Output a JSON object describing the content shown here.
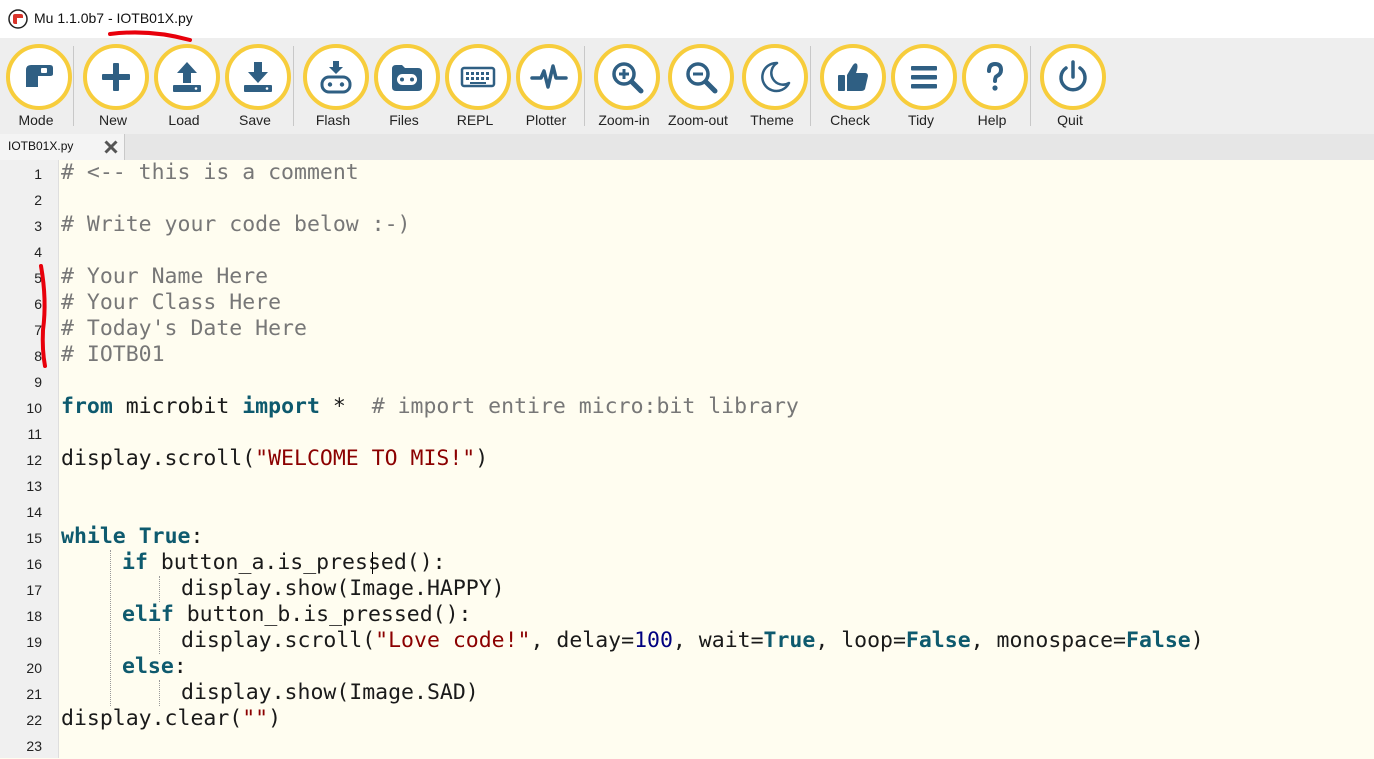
{
  "window": {
    "app_name": "Mu 1.1.0b7",
    "separator": " - ",
    "file_name": "IOTB01X.py"
  },
  "toolbar": {
    "buttons": [
      {
        "label": "Mode",
        "icon": "mode-icon"
      },
      {
        "label": "New",
        "icon": "plus-icon"
      },
      {
        "label": "Load",
        "icon": "upload-icon"
      },
      {
        "label": "Save",
        "icon": "download-icon"
      },
      {
        "label": "Flash",
        "icon": "flash-device-icon"
      },
      {
        "label": "Files",
        "icon": "microbit-icon"
      },
      {
        "label": "REPL",
        "icon": "keyboard-icon"
      },
      {
        "label": "Plotter",
        "icon": "pulse-icon"
      },
      {
        "label": "Zoom-in",
        "icon": "zoom-in-icon"
      },
      {
        "label": "Zoom-out",
        "icon": "zoom-out-icon"
      },
      {
        "label": "Theme",
        "icon": "moon-icon"
      },
      {
        "label": "Check",
        "icon": "thumbs-up-icon"
      },
      {
        "label": "Tidy",
        "icon": "lines-icon"
      },
      {
        "label": "Help",
        "icon": "question-icon"
      },
      {
        "label": "Quit",
        "icon": "power-icon"
      }
    ]
  },
  "tabs": [
    {
      "label": "IOTB01X.py",
      "close_icon": "close-icon"
    }
  ],
  "editor": {
    "line_numbers": [
      "1",
      "2",
      "3",
      "4",
      "5",
      "6",
      "7",
      "8",
      "9",
      "10",
      "11",
      "12",
      "13",
      "14",
      "15",
      "16",
      "17",
      "18",
      "19",
      "20",
      "21",
      "22",
      "23"
    ],
    "lines": {
      "l1": "# <-- this is a comment",
      "l3": "# Write your code below :-)",
      "l5": "# Your Name Here",
      "l6": "# Your Class Here",
      "l7": "# Today's Date Here",
      "l8": "# IOTB01",
      "l10_kw1": "from",
      "l10_mod": " microbit ",
      "l10_kw2": "import",
      "l10_star": " *  ",
      "l10_comment": "# import entire micro:bit library",
      "l12_a": "display.scroll(",
      "l12_str": "\"WELCOME TO MIS!\"",
      "l12_b": ")",
      "l15_kw1": "while",
      "l15_sp": " ",
      "l15_kw2": "True",
      "l15_colon": ":",
      "l16_kw": "if",
      "l16_a": " button_a.is_pressed():",
      "l17": "display.show(Image.HAPPY)",
      "l18_kw": "elif",
      "l18_a": " button_b.is_pressed():",
      "l19_a": "display.scroll(",
      "l19_str": "\"Love code!\"",
      "l19_b": ", delay=",
      "l19_num": "100",
      "l19_c": ", wait=",
      "l19_kw1": "True",
      "l19_d": ", loop=",
      "l19_kw2": "False",
      "l19_e": ", monospace=",
      "l19_kw3": "False",
      "l19_f": ")",
      "l20_kw": "else",
      "l20_colon": ":",
      "l21": "display.show(Image.SAD)",
      "l22_a": "display.clear(",
      "l22_str": "\"\"",
      "l22_b": ")"
    }
  },
  "colors": {
    "toolbar_ring": "#f7cd3c",
    "icon": "#2f5f83",
    "editor_background": "#fffdf0",
    "keyword": "#0e5a6e",
    "string": "#8b0000",
    "comment": "#777777",
    "annotation": "#e8000b"
  }
}
